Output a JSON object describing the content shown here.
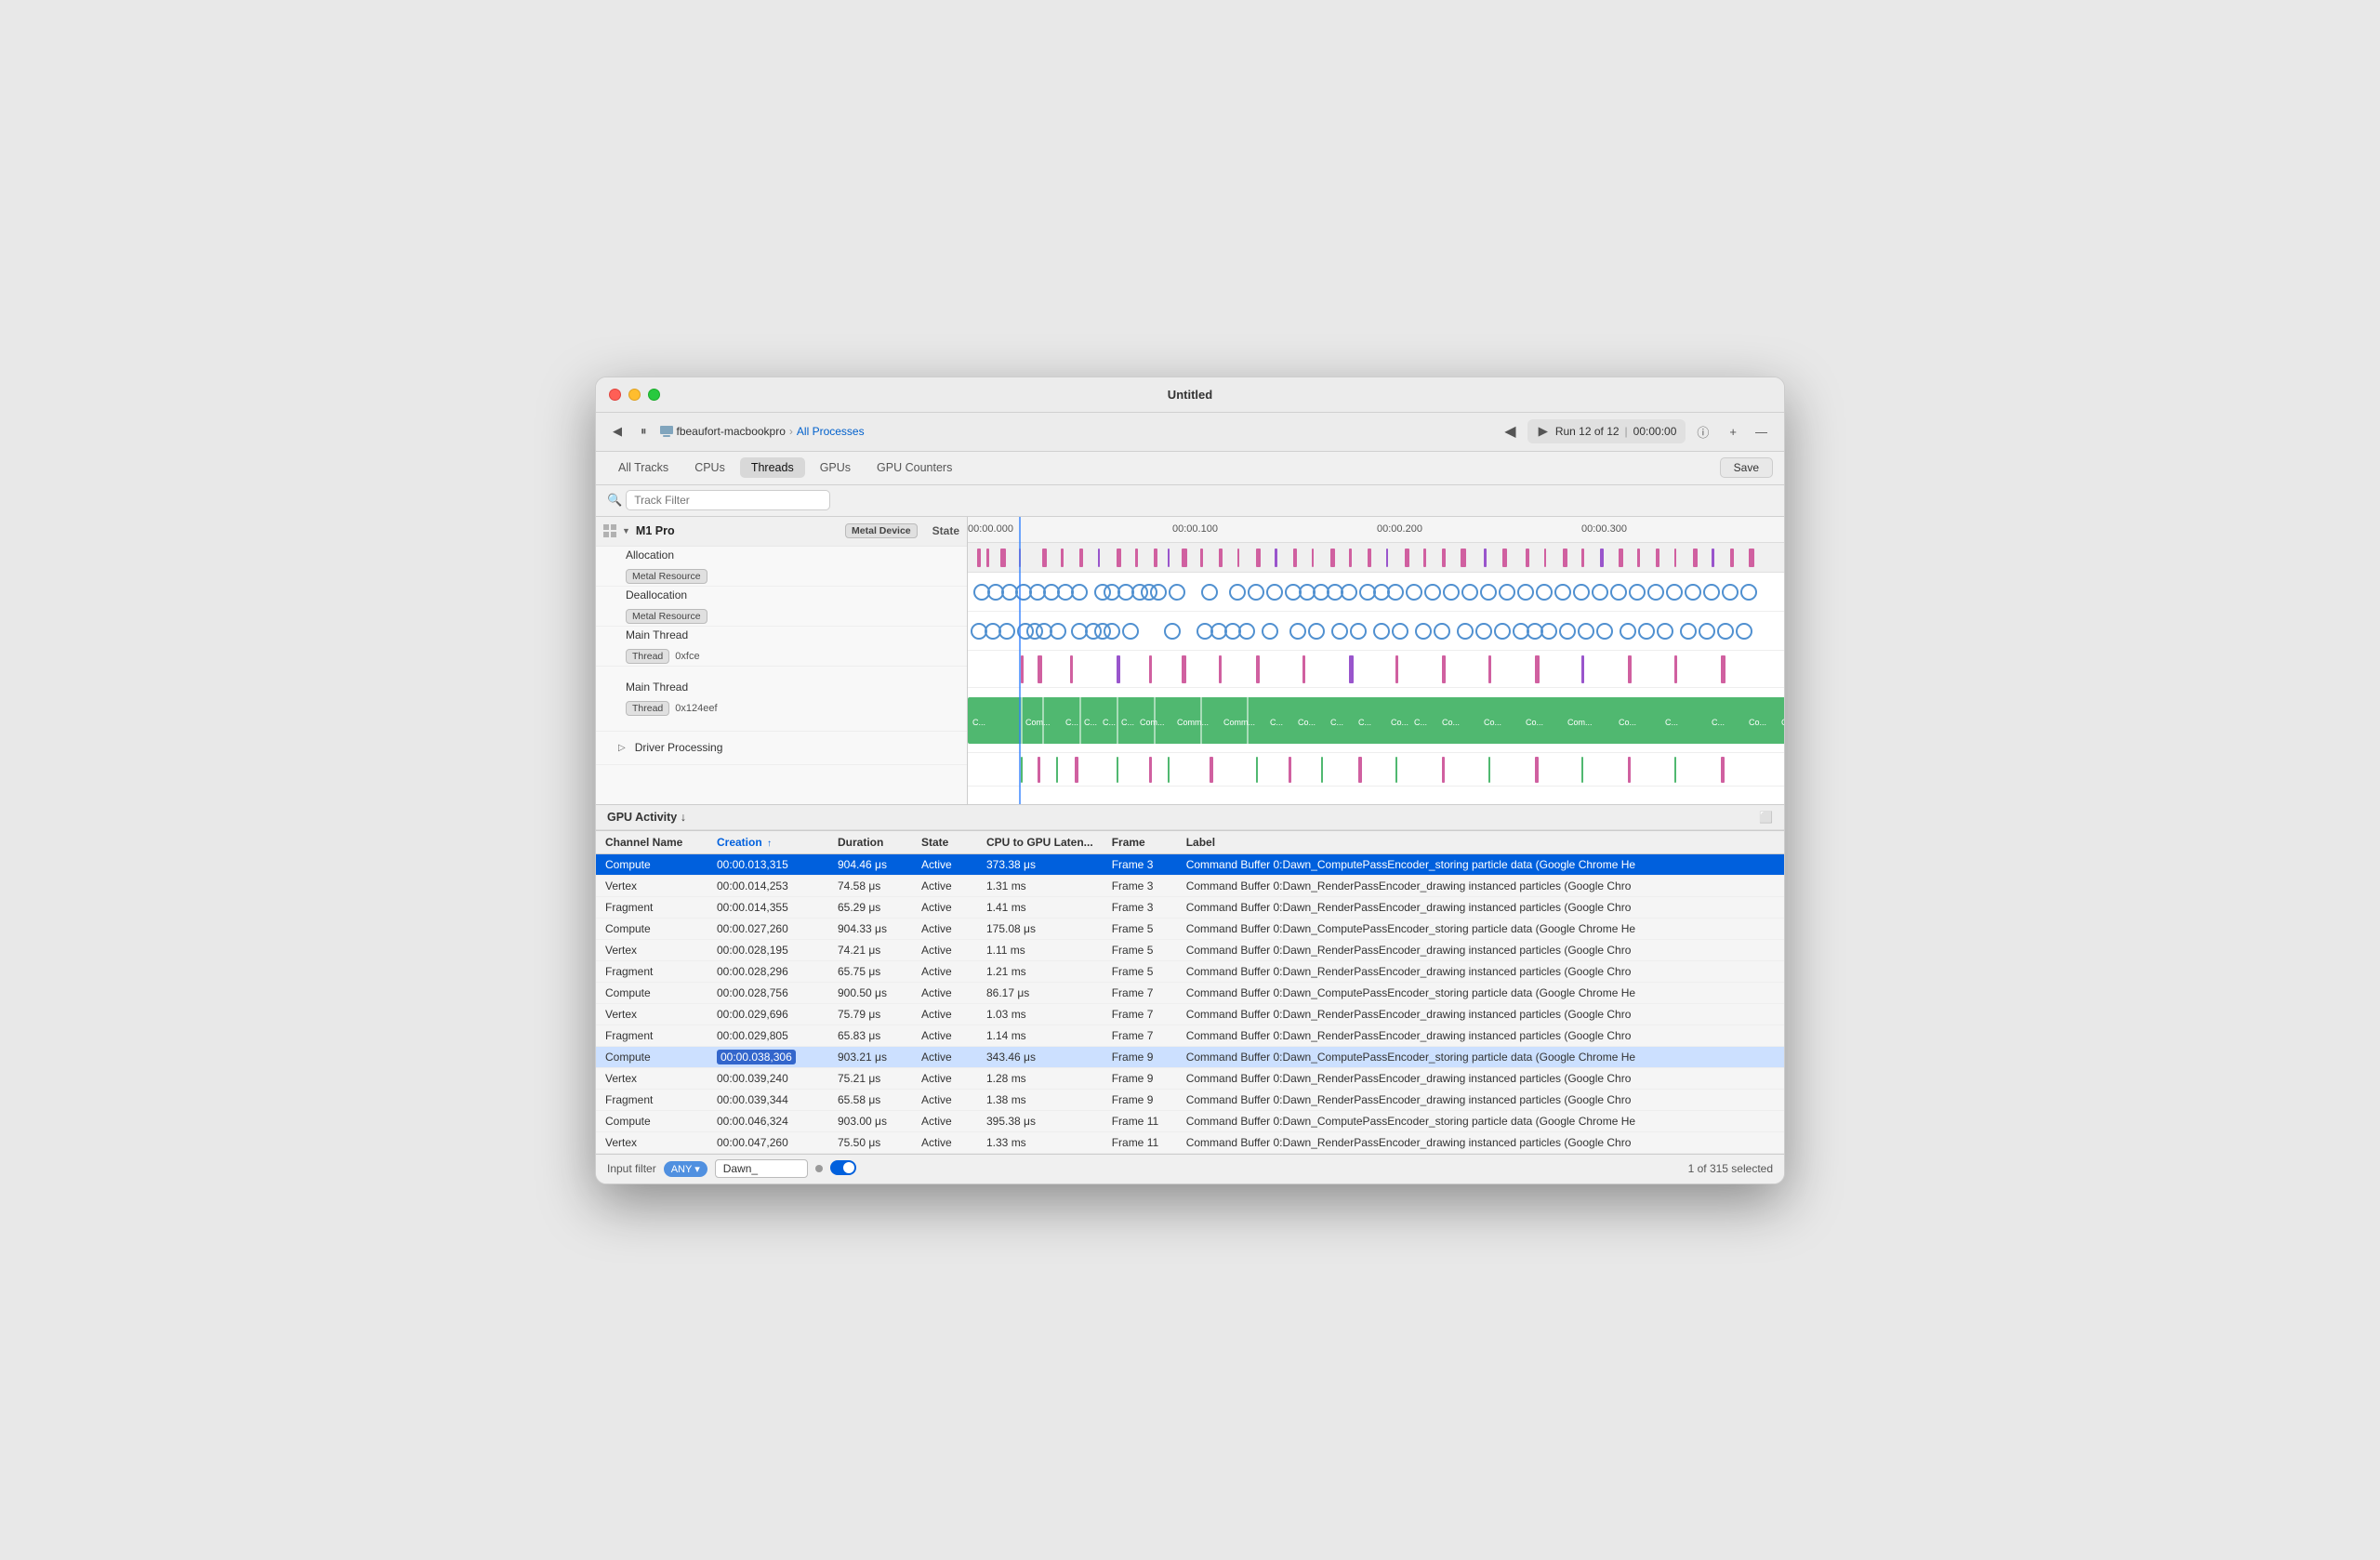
{
  "window": {
    "title": "Untitled"
  },
  "toolbar": {
    "back_btn": "◀",
    "pause_btn": "⏸",
    "computer_label": "fbeaufort-macbookpro",
    "processes_label": "All Processes",
    "run_label": "Run 12 of 12",
    "time_label": "00:00:00",
    "info_btn": "ℹ",
    "add_btn": "+",
    "minimize_btn": "—",
    "save_label": "Save"
  },
  "search": {
    "placeholder": "Track Filter"
  },
  "tabs": [
    {
      "id": "all",
      "label": "All Tracks"
    },
    {
      "id": "cpus",
      "label": "CPUs"
    },
    {
      "id": "threads",
      "label": "Threads"
    },
    {
      "id": "gpus",
      "label": "GPUs"
    },
    {
      "id": "gpu-counters",
      "label": "GPU Counters"
    }
  ],
  "timeline": {
    "markers": [
      "00:00.000",
      "00:00.100",
      "00:00.200",
      "00:00.300"
    ],
    "tracks": [
      {
        "type": "group",
        "label": "M1 Pro",
        "chip": "Metal Device",
        "state_col": "State"
      },
      {
        "type": "row",
        "label": "Allocation",
        "chip": "Metal Resource",
        "height": "normal"
      },
      {
        "type": "row",
        "label": "Deallocation",
        "chip": "Metal Resource",
        "height": "normal"
      },
      {
        "type": "row",
        "label": "Main Thread",
        "chip": "Thread",
        "chip2": "0xfce",
        "height": "normal"
      },
      {
        "type": "row",
        "label": "Main Thread",
        "chip": "Thread",
        "chip2": "0x124eef",
        "height": "tall"
      },
      {
        "type": "row",
        "label": "Driver Processing",
        "expand": true,
        "height": "normal"
      }
    ]
  },
  "gpu_activity": {
    "header": "GPU Activity ↓",
    "columns": [
      {
        "id": "channel",
        "label": "Channel Name"
      },
      {
        "id": "creation",
        "label": "Creation",
        "sort": "asc"
      },
      {
        "id": "duration",
        "label": "Duration"
      },
      {
        "id": "state",
        "label": "State"
      },
      {
        "id": "latency",
        "label": "CPU to GPU Laten..."
      },
      {
        "id": "frame",
        "label": "Frame"
      },
      {
        "id": "label_col",
        "label": "Label"
      }
    ],
    "rows": [
      {
        "channel": "Compute",
        "creation": "00:00.013,315",
        "duration": "904.46 μs",
        "state": "Active",
        "latency": "373.38 μs",
        "frame": "Frame 3",
        "label": "Command Buffer 0:Dawn_ComputePassEncoder_storing particle data   (Google Chrome He",
        "selected": true
      },
      {
        "channel": "Vertex",
        "creation": "00:00.014,253",
        "duration": "74.58 μs",
        "state": "Active",
        "latency": "1.31 ms",
        "frame": "Frame 3",
        "label": "Command Buffer 0:Dawn_RenderPassEncoder_drawing instanced particles   (Google Chro",
        "selected": false
      },
      {
        "channel": "Fragment",
        "creation": "00:00.014,355",
        "duration": "65.29 μs",
        "state": "Active",
        "latency": "1.41 ms",
        "frame": "Frame 3",
        "label": "Command Buffer 0:Dawn_RenderPassEncoder_drawing instanced particles   (Google Chro",
        "selected": false
      },
      {
        "channel": "Compute",
        "creation": "00:00.027,260",
        "duration": "904.33 μs",
        "state": "Active",
        "latency": "175.08 μs",
        "frame": "Frame 5",
        "label": "Command Buffer 0:Dawn_ComputePassEncoder_storing particle data   (Google Chrome He",
        "selected": false
      },
      {
        "channel": "Vertex",
        "creation": "00:00.028,195",
        "duration": "74.21 μs",
        "state": "Active",
        "latency": "1.11 ms",
        "frame": "Frame 5",
        "label": "Command Buffer 0:Dawn_RenderPassEncoder_drawing instanced particles   (Google Chro",
        "selected": false
      },
      {
        "channel": "Fragment",
        "creation": "00:00.028,296",
        "duration": "65.75 μs",
        "state": "Active",
        "latency": "1.21 ms",
        "frame": "Frame 5",
        "label": "Command Buffer 0:Dawn_RenderPassEncoder_drawing instanced particles   (Google Chro",
        "selected": false
      },
      {
        "channel": "Compute",
        "creation": "00:00.028,756",
        "duration": "900.50 μs",
        "state": "Active",
        "latency": "86.17 μs",
        "frame": "Frame 7",
        "label": "Command Buffer 0:Dawn_ComputePassEncoder_storing particle data   (Google Chrome He",
        "selected": false
      },
      {
        "channel": "Vertex",
        "creation": "00:00.029,696",
        "duration": "75.79 μs",
        "state": "Active",
        "latency": "1.03 ms",
        "frame": "Frame 7",
        "label": "Command Buffer 0:Dawn_RenderPassEncoder_drawing instanced particles   (Google Chro",
        "selected": false
      },
      {
        "channel": "Fragment",
        "creation": "00:00.029,805",
        "duration": "65.83 μs",
        "state": "Active",
        "latency": "1.14 ms",
        "frame": "Frame 7",
        "label": "Command Buffer 0:Dawn_RenderPassEncoder_drawing instanced particles   (Google Chro",
        "selected": false
      },
      {
        "channel": "Compute",
        "creation": "00:00.038,306",
        "duration": "903.21 μs",
        "state": "Active",
        "latency": "343.46 μs",
        "frame": "Frame 9",
        "label": "Command Buffer 0:Dawn_ComputePassEncoder_storing particle data   (Google Chrome He",
        "selected": false,
        "highlight": true
      },
      {
        "channel": "Vertex",
        "creation": "00:00.039,240",
        "duration": "75.21 μs",
        "state": "Active",
        "latency": "1.28 ms",
        "frame": "Frame 9",
        "label": "Command Buffer 0:Dawn_RenderPassEncoder_drawing instanced particles   (Google Chro",
        "selected": false
      },
      {
        "channel": "Fragment",
        "creation": "00:00.039,344",
        "duration": "65.58 μs",
        "state": "Active",
        "latency": "1.38 ms",
        "frame": "Frame 9",
        "label": "Command Buffer 0:Dawn_RenderPassEncoder_drawing instanced particles   (Google Chro",
        "selected": false
      },
      {
        "channel": "Compute",
        "creation": "00:00.046,324",
        "duration": "903.00 μs",
        "state": "Active",
        "latency": "395.38 μs",
        "frame": "Frame 11",
        "label": "Command Buffer 0:Dawn_ComputePassEncoder_storing particle data   (Google Chrome He",
        "selected": false
      },
      {
        "channel": "Vertex",
        "creation": "00:00.047,260",
        "duration": "75.50 μs",
        "state": "Active",
        "latency": "1.33 ms",
        "frame": "Frame 11",
        "label": "Command Buffer 0:Dawn_RenderPassEncoder_drawing instanced particles   (Google Chro",
        "selected": false
      }
    ]
  },
  "status_bar": {
    "filter_label": "Input filter",
    "filter_condition": "ANY",
    "filter_value": "Dawn_",
    "selection_info": "1 of 315 selected"
  }
}
